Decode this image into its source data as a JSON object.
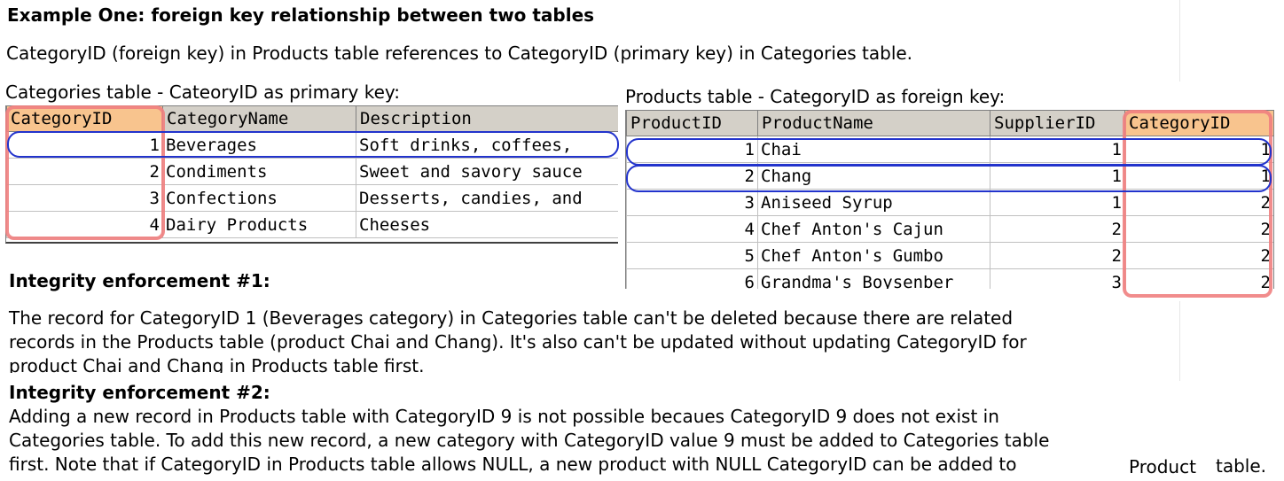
{
  "title": "Example One: foreign key relationship between two tables",
  "intro": "CategoryID (foreign key) in Products table references to CategoryID (primary key) in Categories table.",
  "categories_caption": "Categories table - CateoryID as primary key:",
  "products_caption": "Products table - CategoryID as foreign key:",
  "categories_table": {
    "headers": [
      "CategoryID",
      "CategoryName",
      "Description"
    ],
    "rows": [
      [
        "1",
        "Beverages",
        "Soft drinks, coffees,"
      ],
      [
        "2",
        "Condiments",
        "Sweet and savory sauce"
      ],
      [
        "3",
        "Confections",
        "Desserts, candies, and"
      ],
      [
        "4",
        "Dairy Products",
        "Cheeses"
      ]
    ]
  },
  "products_table": {
    "headers": [
      "ProductID",
      "ProductName",
      "SupplierID",
      "CategoryID"
    ],
    "rows": [
      [
        "1",
        "Chai",
        "1",
        "1"
      ],
      [
        "2",
        "Chang",
        "1",
        "1"
      ],
      [
        "3",
        "Aniseed Syrup",
        "1",
        "2"
      ],
      [
        "4",
        "Chef Anton's Cajun",
        "2",
        "2"
      ],
      [
        "5",
        "Chef Anton's Gumbo",
        "2",
        "2"
      ],
      [
        "6",
        "Grandma's Boysenber",
        "3",
        "2"
      ]
    ]
  },
  "integrity1": {
    "heading": "Integrity enforcement #1:",
    "lines": [
      "The record for CategoryID 1 (Beverages category) in Categories table can't be deleted because there are related",
      "records in the Products table (product Chai and Chang). It's also can't be updated without updating CategoryID for",
      "product Chai and Chang in Products table first."
    ]
  },
  "integrity2": {
    "heading": "Integrity enforcement #2:",
    "lines": [
      "Adding a new record in Products table with CategoryID 9 is not possible becaues CategoryID 9 does not exist in",
      "Categories table. To add this new record, a new category with CategoryID value 9 must be added to Categories table",
      "first. Note that if CategoryID in Products table allows NULL, a new product with NULL CategoryID can be added to"
    ],
    "tail_word": "Product",
    "tail_end": "table."
  },
  "colors": {
    "pk_fk_box": "#f08080",
    "row_box": "#2233cc",
    "header_bg": "#d4d0c8",
    "fk_header_bg": "#f8c48e"
  }
}
